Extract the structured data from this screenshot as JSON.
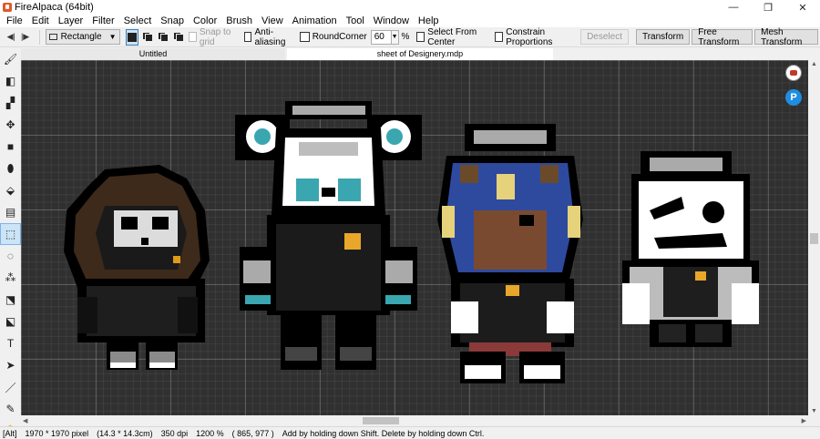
{
  "window": {
    "title": "FireAlpaca (64bit)"
  },
  "menu": [
    "File",
    "Edit",
    "Layer",
    "Filter",
    "Select",
    "Snap",
    "Color",
    "Brush",
    "View",
    "Animation",
    "Tool",
    "Window",
    "Help"
  ],
  "toolbar": {
    "shape_value": "Rectangle",
    "snap_to_grid": "Snap to grid",
    "anti_aliasing": "Anti-aliasing",
    "round_corner": "RoundCorner",
    "round_corner_value": "60",
    "percent": "%",
    "select_from_center": "Select From Center",
    "constrain_proportions": "Constrain Proportions",
    "deselect": "Deselect",
    "transform": "Transform",
    "free_transform": "Free Transform",
    "mesh_transform": "Mesh Transform"
  },
  "tools": [
    {
      "name": "brush-tool-icon",
      "glyph": "🖌"
    },
    {
      "name": "eraser-tool-icon",
      "glyph": "◧"
    },
    {
      "name": "dot-tool-icon",
      "glyph": "▞"
    },
    {
      "name": "move-tool-icon",
      "glyph": "✥"
    },
    {
      "name": "fill-rect-tool-icon",
      "glyph": "■"
    },
    {
      "name": "lasso-fill-tool-icon",
      "glyph": "⬮"
    },
    {
      "name": "bucket-tool-icon",
      "glyph": "⬙"
    },
    {
      "name": "gradient-tool-icon",
      "glyph": "▤"
    },
    {
      "name": "select-tool-icon",
      "glyph": "⬚",
      "active": true
    },
    {
      "name": "lasso-tool-icon",
      "glyph": "◌"
    },
    {
      "name": "magic-wand-tool-icon",
      "glyph": "⁂"
    },
    {
      "name": "select-pen-tool-icon",
      "glyph": "⬔"
    },
    {
      "name": "select-eraser-tool-icon",
      "glyph": "⬕"
    },
    {
      "name": "text-tool-icon",
      "glyph": "T"
    },
    {
      "name": "operation-tool-icon",
      "glyph": "➤"
    },
    {
      "name": "divide-tool-icon",
      "glyph": "／"
    },
    {
      "name": "eyedropper-tool-icon",
      "glyph": "✎"
    },
    {
      "name": "hand-tool-icon",
      "glyph": "✋"
    }
  ],
  "tabs": [
    {
      "label": "Untitled",
      "active": false
    },
    {
      "label": "sheet of Designery.mdp",
      "active": true
    }
  ],
  "status": {
    "mode": "[Alt]",
    "pixels": "1970 * 1970 pixel",
    "size": "(14.3 * 14.3cm)",
    "dpi": "350 dpi",
    "zoom": "1200 %",
    "coords": "( 865, 977 )",
    "hint": "Add by holding down Shift. Delete by holding down Ctrl."
  },
  "colors": {
    "canvas_bg": "#303030",
    "selection": "#cce4f7"
  },
  "floating": {
    "p_label": "P"
  }
}
